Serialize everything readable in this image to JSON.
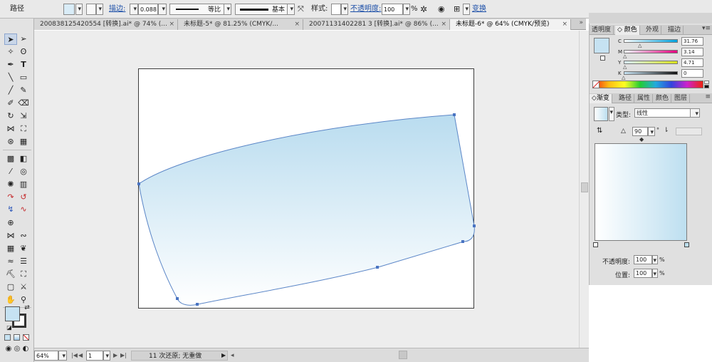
{
  "control_bar": {
    "object_type": "路径",
    "stroke_label": "描边:",
    "stroke_weight": "0.088",
    "profile_label": "等比",
    "brush_label": "基本",
    "style_label": "样式:",
    "opacity_label": "不透明度:",
    "opacity_value": "100",
    "opacity_unit": "%",
    "transform_label": "变换"
  },
  "document_tabs": [
    {
      "label": "200838125420554  [转换].ai* @ 74% (...",
      "close": "×"
    },
    {
      "label": "未标题-5* @ 81.25% (CMYK/...",
      "close": "×"
    },
    {
      "label": "20071131402281 3  [转换].ai* @ 86% (...",
      "close": "×"
    },
    {
      "label": "未标题-6* @ 64% (CMYK/预览)",
      "close": "×"
    }
  ],
  "color_panel": {
    "tabs": [
      "透明度",
      "颜色",
      "外观",
      "描边"
    ],
    "channels": [
      {
        "label": "C",
        "value": "31.76"
      },
      {
        "label": "M",
        "value": "3.14"
      },
      {
        "label": "Y",
        "value": "4.71"
      },
      {
        "label": "K",
        "value": "0"
      }
    ],
    "fill_color": "#c6e2f2"
  },
  "gradient_panel": {
    "tabs": [
      "渐变",
      "路径",
      "属性",
      "颜色",
      "图层"
    ],
    "type_label": "类型:",
    "type_value": "线性",
    "angle_value": "90",
    "angle_unit": "°",
    "start_color": "#ffffff",
    "end_color": "#bddff0",
    "opacity_label": "不透明度:",
    "opacity_value": "100",
    "location_label": "位置:",
    "location_value": "100",
    "unit": "%"
  },
  "status_bar": {
    "zoom": "64%",
    "page": "1",
    "history": "11 次还原; 无重做"
  },
  "artwork": {
    "shape_top_color": "#b9dcef",
    "shape_bottom_color": "#ffffff",
    "stroke_color": "#5b86c7"
  }
}
